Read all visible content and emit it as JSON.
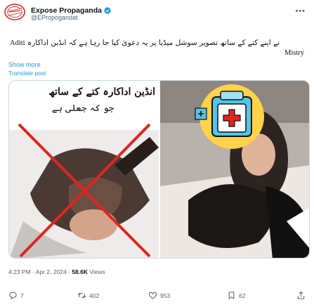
{
  "author": {
    "name": "Expose Propaganda",
    "handle": "@EPropogandat"
  },
  "tweet": {
    "text_urdu_a": "سوشل میڈیا پر یہ دعویٰ کیا جا رہا ہے کہ انڈین اداکارہ",
    "text_latin_a": "Aditi",
    "text_urdu_b": "نے اپنے کتے کے ساتھ تصویر",
    "text_latin_b": "Mistry",
    "show_more": "Show more",
    "translate": "Translate post"
  },
  "media": {
    "left_caption_line1": "انڈین اداکارہ کتے کے ساتھ",
    "left_caption_line2": "جو کہ جعلی ہے",
    "left_status": "fake-marked"
  },
  "meta": {
    "time": "4:23 PM",
    "date": "Apr 2, 2024",
    "views_count": "58.6K",
    "views_label": "Views",
    "separator": "·"
  },
  "actions": {
    "replies": "7",
    "reposts": "402",
    "likes": "953",
    "bookmarks": "62"
  },
  "colors": {
    "accent": "#1d9bf0",
    "muted": "#536471",
    "cross": "#e0241f",
    "badge": "#4ac4e8"
  },
  "icons": [
    "verified-badge-icon",
    "more-icon",
    "reply-icon",
    "repost-icon",
    "like-icon",
    "bookmark-icon",
    "share-icon"
  ]
}
